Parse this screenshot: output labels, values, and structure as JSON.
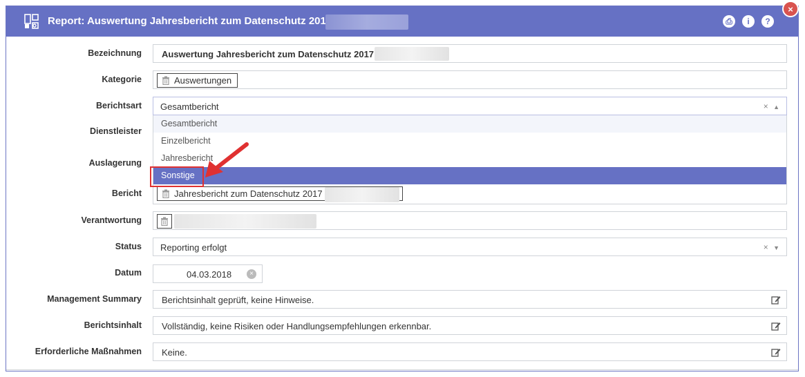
{
  "window": {
    "title": "Report: Auswertung Jahresbericht zum Datenschutz 2017",
    "buttons": {
      "pdf": "⎙",
      "info": "i",
      "help": "?",
      "close": "×"
    }
  },
  "form": {
    "bezeichnung": {
      "label": "Bezeichnung",
      "value": "Auswertung Jahresbericht zum Datenschutz 2017"
    },
    "kategorie": {
      "label": "Kategorie",
      "tag": "Auswertungen"
    },
    "berichtsart": {
      "label": "Berichtsart",
      "value": "Gesamtbericht",
      "clear": "×",
      "options": [
        "Gesamtbericht",
        "Einzelbericht",
        "Jahresbericht",
        "Sonstige"
      ]
    },
    "dienstleister": {
      "label": "Dienstleister"
    },
    "auslagerung": {
      "label": "Auslagerung"
    },
    "bericht": {
      "label": "Bericht",
      "tag": "Jahresbericht zum Datenschutz 2017"
    },
    "verantwortung": {
      "label": "Verantwortung"
    },
    "status": {
      "label": "Status",
      "value": "Reporting erfolgt",
      "clear": "×"
    },
    "datum": {
      "label": "Datum",
      "value": "04.03.2018",
      "clear": "×"
    },
    "management_summary": {
      "label": "Management Summary",
      "value": "Berichtsinhalt geprüft, keine Hinweise."
    },
    "berichtsinhalt": {
      "label": "Berichtsinhalt",
      "value": "Vollständig, keine Risiken oder Handlungsempfehlungen erkennbar."
    },
    "massnahmen": {
      "label": "Erforderliche Maßnahmen",
      "value": "Keine."
    }
  },
  "colors": {
    "accent": "#6671c4",
    "highlight": "#e03131"
  },
  "icons": [
    "report-icon",
    "pdf-icon",
    "info-icon",
    "help-icon",
    "close-icon",
    "trash-icon",
    "edit-icon",
    "clear-icon",
    "caret-up-icon",
    "caret-down-icon",
    "arrow-pointer"
  ]
}
